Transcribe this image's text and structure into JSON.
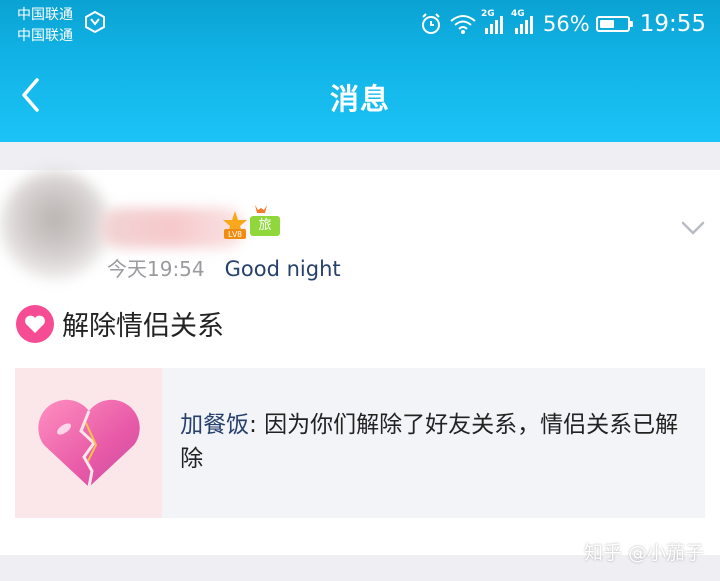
{
  "status_bar": {
    "carrier_1": "中国联通",
    "carrier_2": "中国联通",
    "net_1": "2G",
    "net_2": "4G",
    "battery": "56%",
    "battery_level": 0.56,
    "time": "19:55"
  },
  "nav": {
    "title": "消息"
  },
  "message": {
    "time": "今天19:54",
    "text": "Good night",
    "badge_lv": "LV8",
    "badge_travel": "旅"
  },
  "event": {
    "label": "解除情侣关系"
  },
  "notice": {
    "who": "加餐饭",
    "separator": ": ",
    "text": "因为你们解除了好友关系，情侣关系已解除"
  },
  "watermark": "知乎 @小茄子",
  "colors": {
    "brand": "#12B7EC",
    "heart": "#F54C93",
    "link": "#27416C"
  }
}
